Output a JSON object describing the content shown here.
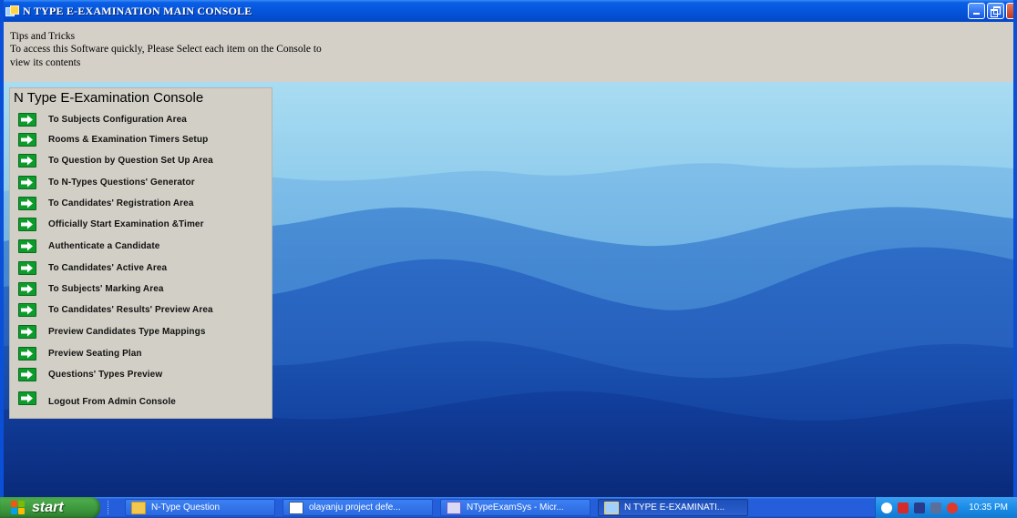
{
  "window": {
    "title": "N TYPE E-EXAMINATION MAIN CONSOLE"
  },
  "tips": {
    "heading": "Tips and Tricks",
    "line1": "To access this Software quickly, Please Select each item on the Console to",
    "line2": "view its contents"
  },
  "console": {
    "title": "N Type E-Examination Console",
    "items": [
      {
        "label": "To Subjects Configuration Area"
      },
      {
        "label": "Rooms & Examination Timers Setup"
      },
      {
        "label": "To Question by Question Set Up Area"
      },
      {
        "label": "To N-Types Questions' Generator"
      },
      {
        "label": "To Candidates' Registration Area"
      },
      {
        "label": "Officially Start Examination &Timer"
      },
      {
        "label": "Authenticate a Candidate"
      },
      {
        "label": "To Candidates' Active Area"
      },
      {
        "label": "To Subjects' Marking Area"
      },
      {
        "label": "To Candidates' Results' Preview Area"
      },
      {
        "label": "Preview Candidates Type Mappings"
      },
      {
        "label": "Preview Seating Plan"
      },
      {
        "label": "Questions' Types Preview"
      },
      {
        "label": "Logout From Admin Console"
      }
    ]
  },
  "taskbar": {
    "start_label": "start",
    "tasks": [
      {
        "label": "N-Type Question",
        "icon": "folder-icon"
      },
      {
        "label": "olayanju project defe...",
        "icon": "word-document-icon"
      },
      {
        "label": "NTypeExamSys - Micr...",
        "icon": "visual-studio-icon"
      },
      {
        "label": "N TYPE E-EXAMINATI...",
        "icon": "app-window-icon"
      }
    ],
    "clock": "10:35 PM"
  },
  "colors": {
    "titlebar": "#0453d9",
    "console_bg": "#d2cfc6",
    "arrow_green": "#0d9c2c",
    "taskbar": "#245edb",
    "start_green": "#3c963c"
  }
}
